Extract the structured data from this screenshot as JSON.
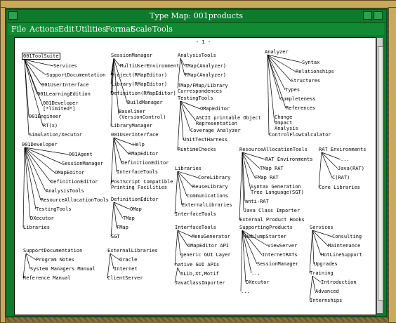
{
  "window": {
    "title": "Type Map: 001products"
  },
  "menu": [
    "File",
    "Actions",
    "Edit",
    "Utilities",
    "Format",
    "Scale",
    "Tools"
  ],
  "page_marker": "- 1 -",
  "labels": [
    "001ToolSuite",
    "Services",
    "SupportDocumentation",
    "001UserInterface",
    "001LearningEdition",
    "001Developer\n[*limited*]",
    "001Engineer",
    "RT(x)",
    "Simulation/Xecutor",
    "SessionManager",
    "MultiUserEnvironment",
    "Project(RMapEditor)",
    "Library(RMapEditor)",
    "Definition(RMapEditor)",
    "BuildManager",
    "Baseliner\n(VersionControl)",
    "LibraryManager",
    "AnalysisTools",
    "TMap(Analyzer)",
    "FMap(Analyzer)",
    "TMap/FMap/Library\nCorrespondences",
    "Analyzer",
    "Syntax",
    "Relationships",
    "Structures",
    "Types",
    "Completeness",
    "References",
    "Change\nImpact\nAnalysis",
    "ControlFlowCalculator",
    "TestingTools",
    "OMapEditor",
    "ASCII printable Object\nRepresentation",
    "Coverage Analyzer",
    "UnitTestHarness",
    "RuntimeChecks",
    "001Developer",
    "001Agent",
    "SessionManager",
    "OMapEditor",
    "DefinitionEditor",
    "AnalysisTools",
    "ResourceAllocationTools",
    "TestingTools",
    "DXecutor",
    "Libraries",
    "001UserInterface",
    "Help",
    "RMapEditor",
    "DefinitionEditor",
    "InterfaceTools",
    "PostScript Compatible\nPrinting Facilities",
    "DefinitionEditor",
    "OMap",
    "TMap",
    "FMap",
    "SGT",
    "Libraries",
    "CoreLibrary",
    "ReuseLibrary",
    "Communications",
    "ExternalLibraries",
    "InterfaceTools",
    "ResourceAllocationTools",
    "RAT Environments",
    "TMap RAT",
    "FMap RAT",
    "Syntax Generation\nTree Language(SGT)",
    "anti-RAT",
    "Java Class Importer",
    "External Product Hooks",
    "RAT Environments",
    "...",
    "Java(RAT)",
    "C(RAT)",
    "Core Libraries",
    "SupportDocumentation",
    "Program Notes",
    "System Managers Manual",
    "Reference Manual",
    "ExternalLibraries",
    "Oracle",
    "Internet",
    "ClientServer",
    "InterfaceTools",
    "MenuGenerator",
    "OMapEditor API",
    "generic GUI Layer",
    "native GUI APIs",
    "XLib,Xt,Motif",
    "JavaClassImporter",
    "SupportingProducts",
    "WebJumpStarter",
    "ViewServer",
    "InternetRATs",
    "SessionManager",
    "...",
    "DXecutor",
    "...",
    "Services",
    "Consulting",
    "Maintenance",
    "HotLineSupport",
    "Upgrades",
    "Training",
    "Introduction",
    "Advanced",
    "Internships"
  ]
}
